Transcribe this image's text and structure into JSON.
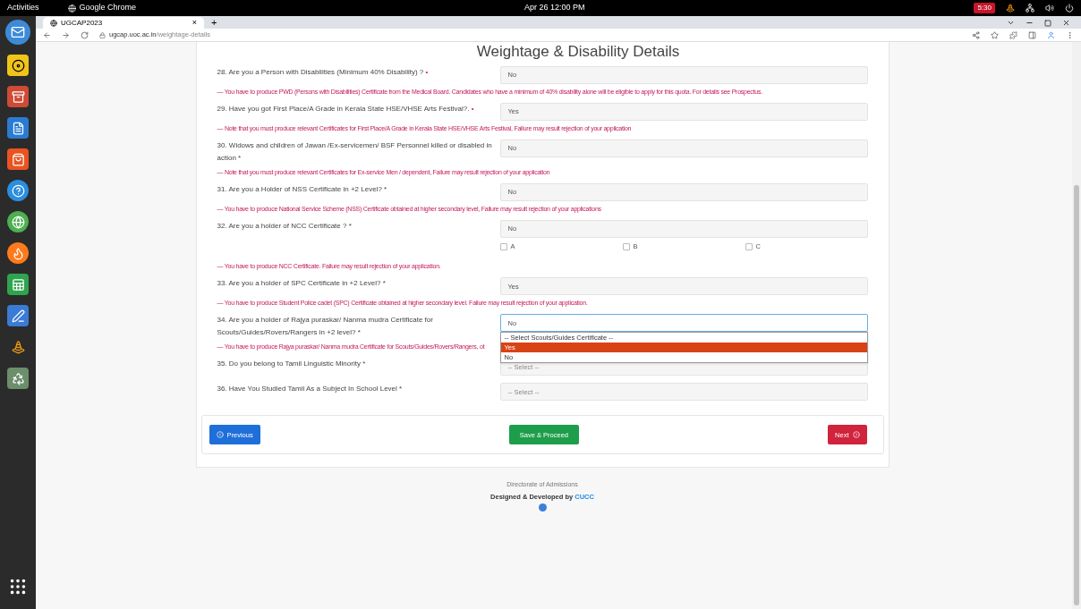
{
  "topbar": {
    "activities": "Activities",
    "app": "Google Chrome",
    "clock": "Apr 26  12:00 PM",
    "badge": "5:30"
  },
  "browser": {
    "tab": {
      "title": "UGCAP2023",
      "close": "×",
      "selected": true
    },
    "new_tab": "+",
    "url_host": "ugcap.uoc.ac.in",
    "url_path": "/weightage-details"
  },
  "page": {
    "heading": "Weightage & Disability Details",
    "questions": [
      {
        "kind": "select",
        "label": "28. Are you a Person with Disabilities (Minimum 40% Disability) ?",
        "mark": "•",
        "value": "No",
        "note": "— You have to produce PWD (Persons with Disabilities) Certificate from the Medical Board. Candidates who have a minimum of 40% disability alone will be eligible to apply for this quota. For details see Prospectus."
      },
      {
        "kind": "select",
        "label": "29. Have you got First Place/A Grade in Kerala State HSE/VHSE Arts Festival?.",
        "mark": "•",
        "value": "Yes",
        "note": "— Note that you must produce relevant Certificates for First Place/A Grade in Kerala State HSE/VHSE Arts Festival, Failure may result rejection of your application"
      },
      {
        "kind": "select",
        "label": "30. Widows and children of Jawan /Ex-servicemen/ BSF Personnel killed or disabled in action",
        "mark": "*",
        "value": "No",
        "note": "— Note that you must produce relevant Certificates for Ex-service Men / dependent, Failure may result rejection of your application"
      },
      {
        "kind": "select",
        "label": "31. Are you a Holder of NSS Certificate in +2 Level?",
        "mark": "*",
        "value": "No",
        "note": "— You have to produce National Service Scheme (NSS) Certificate obtained at higher secondary level, Failure may result rejection of your applications"
      },
      {
        "kind": "checkboxes",
        "label": "32. Are you a holder of NCC Certificate ?",
        "mark": "*",
        "value": "No",
        "options": [
          {
            "label": "A",
            "checked": false
          },
          {
            "label": "B",
            "checked": false
          },
          {
            "label": "C",
            "checked": false
          }
        ],
        "note": "— You have to produce NCC Certificate. Failure may result rejection of your application."
      },
      {
        "kind": "select",
        "label": "33. Are you a holder of SPC Certificate in +2 Level?",
        "mark": "*",
        "value": "Yes",
        "note": "— You have to produce Student Police cadet (SPC) Certificate obtained at higher secondary level. Failure may result rejection of your application."
      },
      {
        "kind": "dropdown",
        "label": "34. Are you a holder of Rajya puraskar/ Nanma mudra Certificate for Scouts/Guides/Rovers/Rangers in +2 level?",
        "mark": "*",
        "value": "No",
        "options": [
          {
            "label": "-- Select Scouts/Guides Certificate --",
            "highlighted": false
          },
          {
            "label": "Yes",
            "highlighted": true
          },
          {
            "label": "No",
            "highlighted": false
          }
        ],
        "note": "— You have to produce Rajya puraskar/ Nanma mudra Certificate for Scouts/Guides/Rovers/Rangers, ot"
      },
      {
        "kind": "select",
        "label": "35. Do you belong to Tamil Linguistic Minority",
        "mark": "*",
        "placeholder": "-- Select --"
      },
      {
        "kind": "select",
        "label": "36. Have You Studied Tamil As a Subject In School Level",
        "mark": "*",
        "placeholder": "-- Select --"
      }
    ],
    "buttons": {
      "previous": "Previous",
      "save": "Save & Proceed",
      "next": "Next"
    },
    "footer": {
      "line1": "Directorate of Admissions",
      "line2_prefix": "Designed & Developed by",
      "line2_brand": "CUCC"
    }
  }
}
